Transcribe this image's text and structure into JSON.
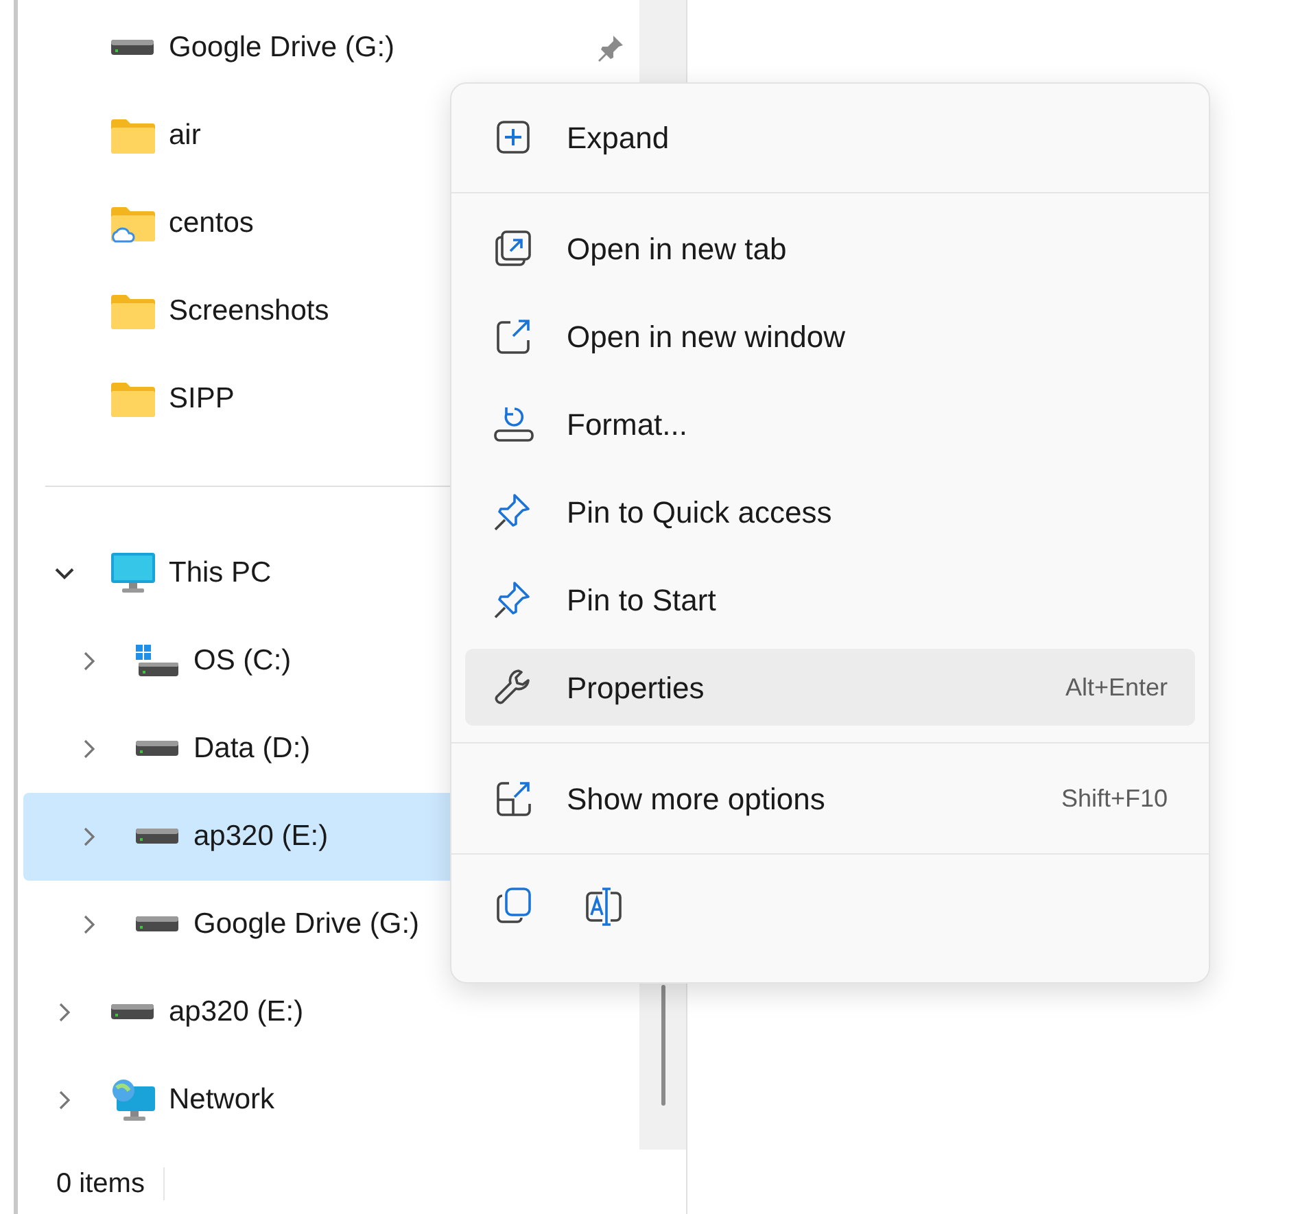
{
  "quick_access": [
    {
      "label": "Google Drive (G:)",
      "kind": "drive",
      "pinned": true
    },
    {
      "label": "air",
      "kind": "folder"
    },
    {
      "label": "centos",
      "kind": "cloud-folder"
    },
    {
      "label": "Screenshots",
      "kind": "folder"
    },
    {
      "label": "SIPP",
      "kind": "folder"
    }
  ],
  "tree": [
    {
      "label": "This PC",
      "kind": "pc",
      "expanded": true,
      "selected": false,
      "children": [
        {
          "label": "OS (C:)",
          "kind": "windows-drive",
          "expanded": false,
          "selected": false
        },
        {
          "label": "Data (D:)",
          "kind": "drive",
          "expanded": false,
          "selected": false
        },
        {
          "label": "ap320 (E:)",
          "kind": "drive",
          "expanded": false,
          "selected": true
        },
        {
          "label": "Google Drive (G:)",
          "kind": "drive",
          "expanded": false,
          "selected": false
        }
      ]
    },
    {
      "label": "ap320 (E:)",
      "kind": "drive",
      "expanded": false,
      "selected": false
    },
    {
      "label": "Network",
      "kind": "network",
      "expanded": false,
      "selected": false
    }
  ],
  "status_bar": {
    "item_count": "0 items"
  },
  "context_menu": {
    "items": [
      {
        "kind": "expand",
        "label": "Expand",
        "selected": false
      },
      {
        "kind": "separator"
      },
      {
        "kind": "new-tab",
        "label": "Open in new tab",
        "selected": false
      },
      {
        "kind": "new-window",
        "label": "Open in new window",
        "selected": false
      },
      {
        "kind": "format",
        "label": "Format...",
        "selected": false
      },
      {
        "kind": "pin",
        "label": "Pin to Quick access",
        "selected": false
      },
      {
        "kind": "pin",
        "label": "Pin to Start",
        "selected": false
      },
      {
        "kind": "properties",
        "label": "Properties",
        "shortcut": "Alt+Enter",
        "selected": true
      },
      {
        "kind": "separator"
      },
      {
        "kind": "more",
        "label": "Show more options",
        "shortcut": "Shift+F10",
        "selected": false
      },
      {
        "kind": "separator"
      }
    ],
    "toolbar": [
      {
        "kind": "copy"
      },
      {
        "kind": "rename"
      }
    ]
  }
}
